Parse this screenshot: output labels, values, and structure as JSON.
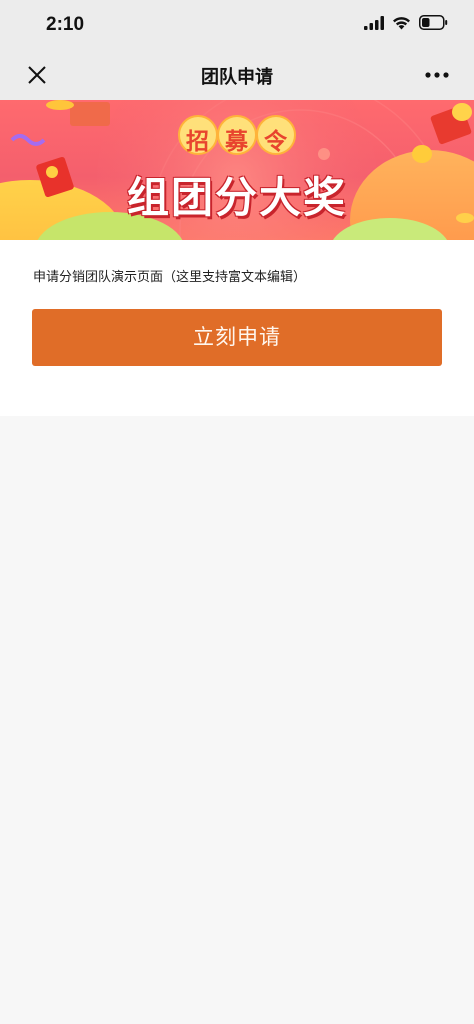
{
  "status_bar": {
    "time": "2:10",
    "icons": [
      "signal-icon",
      "wifi-icon",
      "battery-icon"
    ]
  },
  "nav": {
    "title": "团队申请",
    "left_icon": "close-icon",
    "right_icon": "more-icon"
  },
  "banner": {
    "top_text": [
      "招",
      "募",
      "令"
    ],
    "headline": "组团分大奖"
  },
  "content": {
    "description": "申请分销团队演示页面（这里支持富文本编辑）",
    "apply_button_label": "立刻申请"
  },
  "colors": {
    "accent": "#e06d28",
    "banner_base": "#f45f6d"
  }
}
